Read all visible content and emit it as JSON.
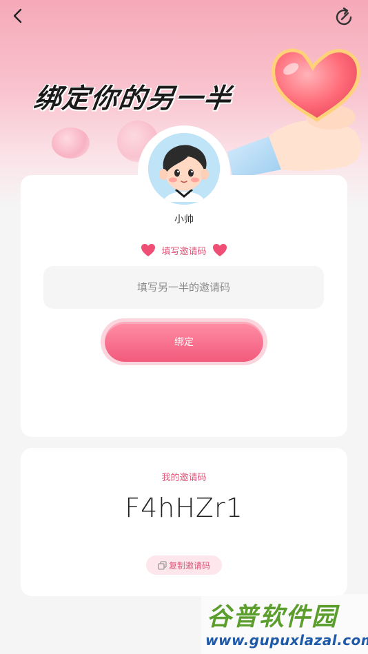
{
  "header": {
    "back_icon": "chevron-left-icon",
    "refresh_icon": "refresh-icon",
    "banner_title": "绑定你的另一半"
  },
  "profile": {
    "username": "小帅"
  },
  "bind_section": {
    "label": "填写邀请码",
    "input_value": "",
    "input_placeholder": "填写另一半的邀请码",
    "bind_button_label": "绑定"
  },
  "my_code_section": {
    "label": "我的邀请码",
    "code": "F4hHZr1",
    "copy_button_label": "复制邀请码",
    "copy_icon": "copy-icon"
  },
  "watermark": {
    "title": "谷普软件园",
    "url": "www.gupuxlazal.com"
  },
  "colors": {
    "accent": "#f25a7c",
    "accent_light": "#fde7ec",
    "label_pink": "#e0577a",
    "hero_pink": "#f6a9b8"
  }
}
